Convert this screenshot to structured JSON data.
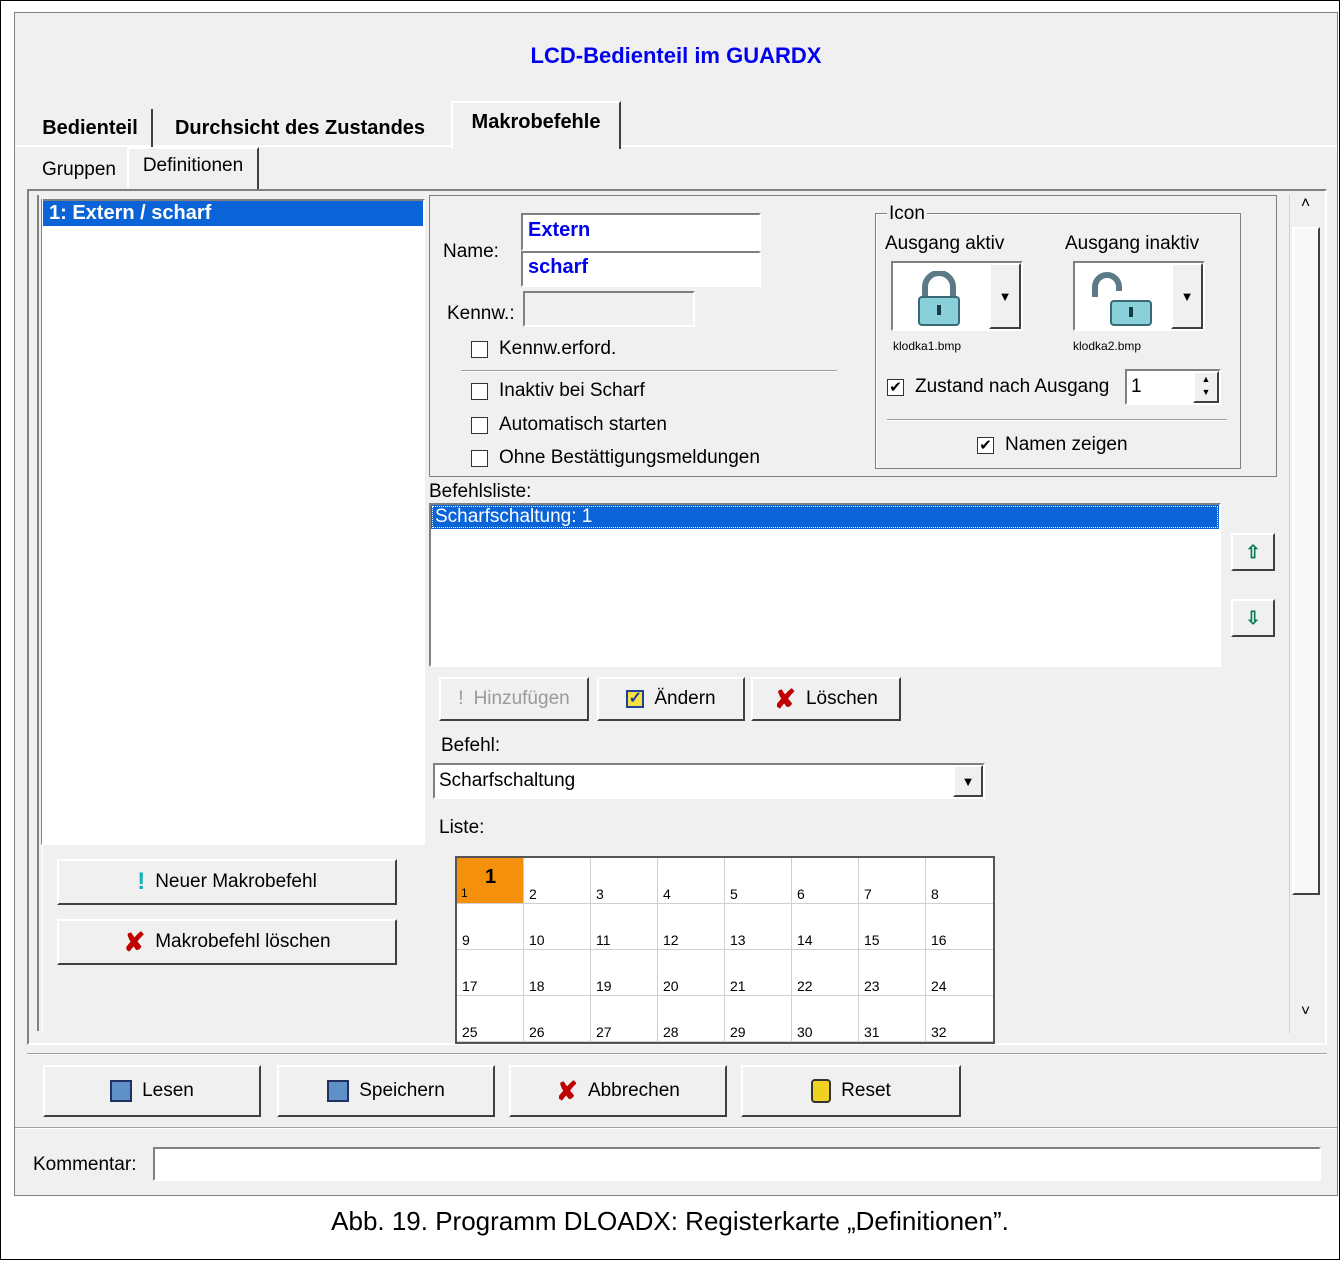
{
  "window": {
    "title": "LCD-Bedienteil im GUARDX"
  },
  "main_tabs": [
    {
      "label": "Bedienteil"
    },
    {
      "label": "Durchsicht des Zustandes"
    },
    {
      "label": "Makrobefehle"
    }
  ],
  "sub_tabs": [
    {
      "label": "Gruppen"
    },
    {
      "label": "Definitionen"
    }
  ],
  "macro_list": {
    "items": [
      "1: Extern / scharf"
    ]
  },
  "left_buttons": {
    "new_label": "Neuer Makrobefehl",
    "delete_label": "Makrobefehl löschen"
  },
  "form": {
    "name_label": "Name:",
    "name_line1": "Extern",
    "name_line2": "scharf",
    "password_label": "Kennw.:",
    "password_value": "",
    "password_required_label": "Kennw.erford.",
    "password_required": false,
    "inactive_armed_label": "Inaktiv bei Scharf",
    "inactive_armed": false,
    "autostart_label": "Automatisch starten",
    "autostart": false,
    "no_confirm_label": "Ohne Bestättigungsmeldungen",
    "no_confirm": false
  },
  "icon_group": {
    "title": "Icon",
    "active_label": "Ausgang aktiv",
    "inactive_label": "Ausgang inaktiv",
    "active_file": "klodka1.bmp",
    "inactive_file": "klodka2.bmp",
    "state_after_output_label": "Zustand nach Ausgang",
    "state_after_output": true,
    "output_value": "1",
    "show_names_label": "Namen zeigen",
    "show_names": true
  },
  "command_list": {
    "label": "Befehlsliste:",
    "items": [
      "Scharfschaltung: 1"
    ]
  },
  "command_buttons": {
    "add": "Hinzufügen",
    "change": "Ändern",
    "delete": "Löschen"
  },
  "command": {
    "label": "Befehl:",
    "value": "Scharfschaltung"
  },
  "liste": {
    "label": "Liste:",
    "numbers": [
      "1",
      "2",
      "3",
      "4",
      "5",
      "6",
      "7",
      "8",
      "9",
      "10",
      "11",
      "12",
      "13",
      "14",
      "15",
      "16",
      "17",
      "18",
      "19",
      "20",
      "21",
      "22",
      "23",
      "24",
      "25",
      "26",
      "27",
      "28",
      "29",
      "30",
      "31",
      "32"
    ],
    "selected_mark": "1"
  },
  "bottom_buttons": {
    "read": "Lesen",
    "save": "Speichern",
    "cancel": "Abbrechen",
    "reset": "Reset"
  },
  "comment": {
    "label": "Kommentar:",
    "value": ""
  },
  "caption": "Abb. 19. Programm DLOADX: Registerkarte „Definitionen”.",
  "colors": {
    "title_text": "#0000ee",
    "selection": "#0a64d8",
    "grid_selected": "#f4900c",
    "delete_x": "#c00000"
  }
}
